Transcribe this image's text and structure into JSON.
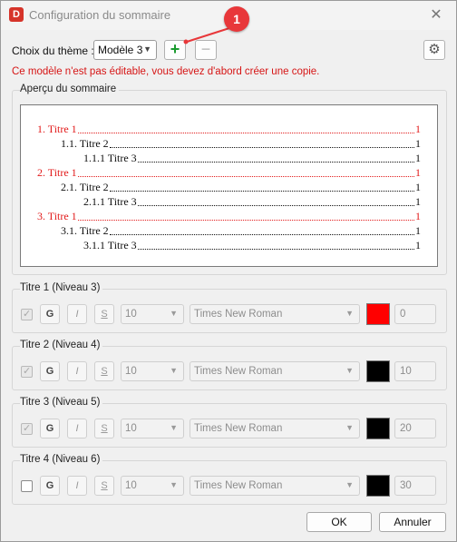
{
  "window": {
    "title": "Configuration du sommaire",
    "logo_letter": "D",
    "close_glyph": "✕"
  },
  "theme": {
    "label": "Choix du thème :",
    "selected": "Modèle 3",
    "add_glyph": "+",
    "remove_glyph": "−",
    "settings_glyph": "⚙"
  },
  "callout": {
    "number": "1"
  },
  "warning": "Ce modèle n'est pas éditable, vous devez d'abord créer une copie.",
  "preview": {
    "legend": "Aperçu du sommaire",
    "entries": [
      {
        "text": "1. Titre 1",
        "page": "1",
        "level": 1
      },
      {
        "text": "1.1. Titre 2",
        "page": "1",
        "level": 2
      },
      {
        "text": "1.1.1 Titre 3",
        "page": "1",
        "level": 3
      },
      {
        "text": "2. Titre 1",
        "page": "1",
        "level": 1
      },
      {
        "text": "2.1. Titre 2",
        "page": "1",
        "level": 2
      },
      {
        "text": "2.1.1 Titre 3",
        "page": "1",
        "level": 3
      },
      {
        "text": "3. Titre 1",
        "page": "1",
        "level": 1
      },
      {
        "text": "3.1. Titre 2",
        "page": "1",
        "level": 2
      },
      {
        "text": "3.1.1 Titre 3",
        "page": "1",
        "level": 3
      }
    ]
  },
  "levels": [
    {
      "title": "Titre 1 (Niveau 3)",
      "checked": true,
      "bold": "G",
      "italic": "I",
      "underline": "S",
      "size": "10",
      "font": "Times New Roman",
      "color": "#ff0000",
      "indent": "0"
    },
    {
      "title": "Titre 2 (Niveau 4)",
      "checked": true,
      "bold": "G",
      "italic": "I",
      "underline": "S",
      "size": "10",
      "font": "Times New Roman",
      "color": "#000000",
      "indent": "10"
    },
    {
      "title": "Titre 3 (Niveau 5)",
      "checked": true,
      "bold": "G",
      "italic": "I",
      "underline": "S",
      "size": "10",
      "font": "Times New Roman",
      "color": "#000000",
      "indent": "20"
    },
    {
      "title": "Titre 4 (Niveau 6)",
      "checked": false,
      "bold": "G",
      "italic": "I",
      "underline": "S",
      "size": "10",
      "font": "Times New Roman",
      "color": "#000000",
      "indent": "30"
    }
  ],
  "footer": {
    "ok": "OK",
    "cancel": "Annuler"
  },
  "colors": {
    "accent_red": "#e8373a",
    "warning_red": "#d61515",
    "preview_level1": "#e21b1b",
    "add_green": "#1a9a2e"
  }
}
